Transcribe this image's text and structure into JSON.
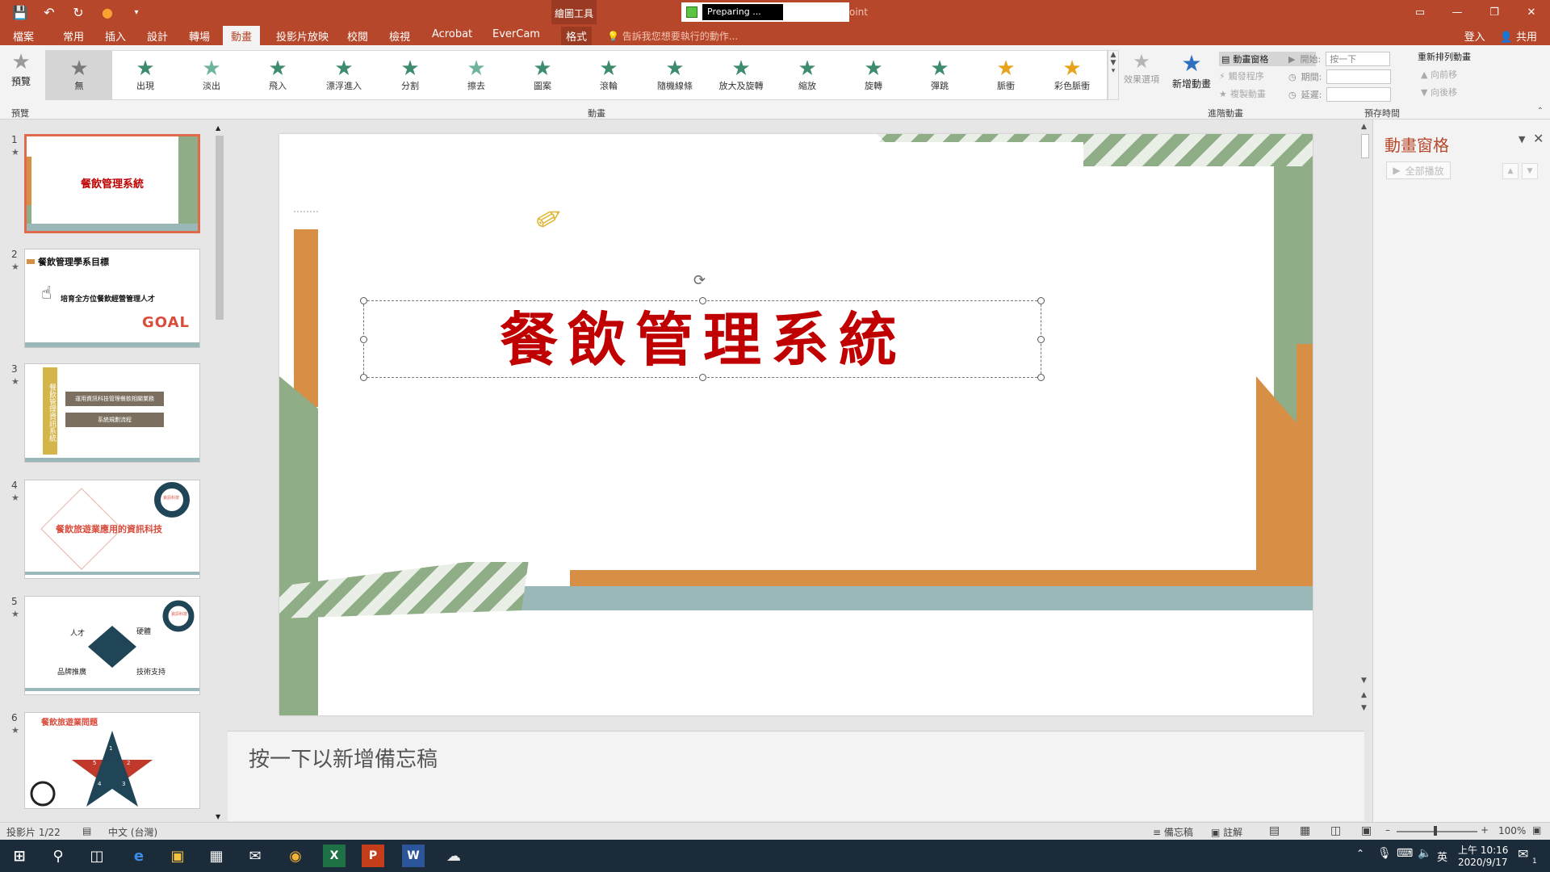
{
  "titlebar": {
    "contextual_group": "繪圖工具",
    "document_status": "Preparing ...",
    "title_suffix": "oint"
  },
  "tabs": [
    "檔案",
    "常用",
    "插入",
    "設計",
    "轉場",
    "動畫",
    "投影片放映",
    "校閱",
    "檢視",
    "Acrobat",
    "EverCam",
    "格式"
  ],
  "active_tab": "動畫",
  "tell_me": "告訴我您想要執行的動作...",
  "account": {
    "signin": "登入",
    "share": "共用"
  },
  "ribbon": {
    "preview_label": "預覽",
    "preview_group": "預覽",
    "animation_group": "動畫",
    "gallery": [
      {
        "label": "無",
        "color": "#7a7a7a"
      },
      {
        "label": "出現",
        "color": "#3e8c6e"
      },
      {
        "label": "淡出",
        "color": "#6fb59b"
      },
      {
        "label": "飛入",
        "color": "#3e8c6e"
      },
      {
        "label": "漂浮進入",
        "color": "#3e8c6e"
      },
      {
        "label": "分割",
        "color": "#3e8c6e"
      },
      {
        "label": "擦去",
        "color": "#6fb59b"
      },
      {
        "label": "圖案",
        "color": "#3e8c6e"
      },
      {
        "label": "滾輪",
        "color": "#3e8c6e"
      },
      {
        "label": "隨機線條",
        "color": "#3e8c6e"
      },
      {
        "label": "放大及旋轉",
        "color": "#3e8c6e"
      },
      {
        "label": "縮放",
        "color": "#3e8c6e"
      },
      {
        "label": "旋轉",
        "color": "#3e8c6e"
      },
      {
        "label": "彈跳",
        "color": "#3e8c6e"
      },
      {
        "label": "脈衝",
        "color": "#e8a31c"
      },
      {
        "label": "彩色脈衝",
        "color": "#e8a31c"
      }
    ],
    "effect_options": "效果選項",
    "advanced_group": "進階動畫",
    "add_animation": "新增動畫",
    "animation_pane_btn": "動畫窗格",
    "trigger": "觸發程序",
    "painter": "複製動畫",
    "timing_group": "預存時間",
    "start_label": "開始:",
    "start_value": "按一下",
    "duration_label": "期間:",
    "delay_label": "延遲:",
    "reorder_title": "重新排列動畫",
    "move_earlier": "向前移",
    "move_later": "向後移"
  },
  "thumbnails": [
    {
      "num": "1",
      "title": "餐飲管理系統"
    },
    {
      "num": "2",
      "title": "餐飲管理學系目標",
      "sub": "培育全方位餐飲經營管理人才",
      "goal": "GOAL"
    },
    {
      "num": "3",
      "side": "餐飲管理資訊系統",
      "box1": "運用資訊科技管理餐飲相關業務",
      "box2": "系統規劃流程"
    },
    {
      "num": "4",
      "title": "餐飲旅遊業應用的資訊科技",
      "badge": "資訊科技"
    },
    {
      "num": "5",
      "labels": [
        "人才",
        "硬體",
        "品牌推廣",
        "技術支持"
      ],
      "badge": "資訊科技"
    },
    {
      "num": "6",
      "title": "餐飲旅遊業問題",
      "items": [
        "1",
        "2",
        "3",
        "4",
        "5"
      ]
    }
  ],
  "slide": {
    "title": "餐飲管理系統"
  },
  "notes_placeholder": "按一下以新增備忘稿",
  "pane": {
    "title": "動畫窗格",
    "play_all": "全部播放"
  },
  "status": {
    "slide_info": "投影片 1/22",
    "language": "中文 (台灣)",
    "notes": "備忘稿",
    "comments": "註解",
    "zoom": "100%"
  },
  "taskbar": {
    "time": "上午 10:16",
    "date": "2020/9/17",
    "ime": "英",
    "notif": "1"
  }
}
